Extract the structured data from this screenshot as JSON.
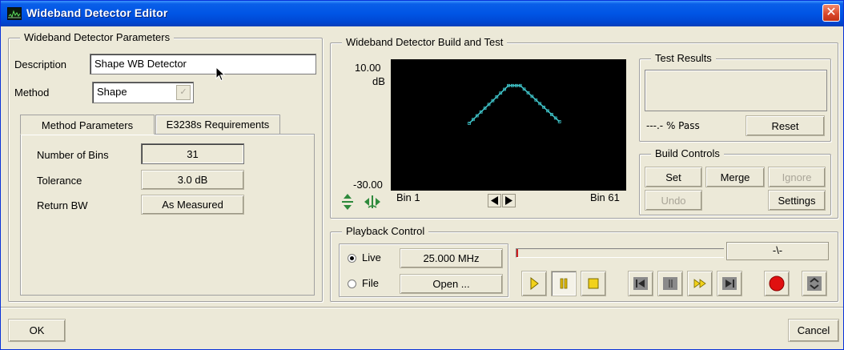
{
  "window": {
    "title": "Wideband Detector Editor",
    "close_glyph": "✕"
  },
  "params": {
    "legend": "Wideband Detector Parameters",
    "description_label": "Description",
    "description_value": "Shape WB Detector",
    "method_label": "Method",
    "method_value": "Shape",
    "tabs": [
      "Method Parameters",
      "E3238s Requirements"
    ],
    "rows": [
      {
        "label": "Number of Bins",
        "value": "31"
      },
      {
        "label": "Tolerance",
        "value": "3.0 dB"
      },
      {
        "label": "Return BW",
        "value": "As Measured"
      }
    ]
  },
  "build": {
    "legend": "Wideband Detector Build and Test",
    "y_top_label": "10.00",
    "y_unit": "dB",
    "y_bottom_label": "-30.00",
    "x_left_label": "Bin 1",
    "x_right_label": "Bin 61",
    "plot_line_color": "#3fc3c8"
  },
  "chart_data": {
    "type": "line",
    "ylim": [
      -30,
      10
    ],
    "xlim": [
      1,
      61
    ],
    "series": [
      {
        "x": [
          21,
          31,
          34,
          44
        ],
        "y": [
          -9.5,
          2,
          2,
          -9
        ]
      }
    ]
  },
  "test_results": {
    "legend": "Test Results",
    "pass_text": "---.- % Pass",
    "reset_label": "Reset"
  },
  "build_controls": {
    "legend": "Build Controls",
    "set_label": "Set",
    "merge_label": "Merge",
    "ignore_label": "Ignore",
    "undo_label": "Undo",
    "settings_label": "Settings"
  },
  "playback": {
    "legend": "Playback Control",
    "live_label": "Live",
    "live_value": "25.000 MHz",
    "file_label": "File",
    "open_label": "Open ...",
    "status_text": "-\\-"
  },
  "footer": {
    "ok_label": "OK",
    "cancel_label": "Cancel"
  }
}
